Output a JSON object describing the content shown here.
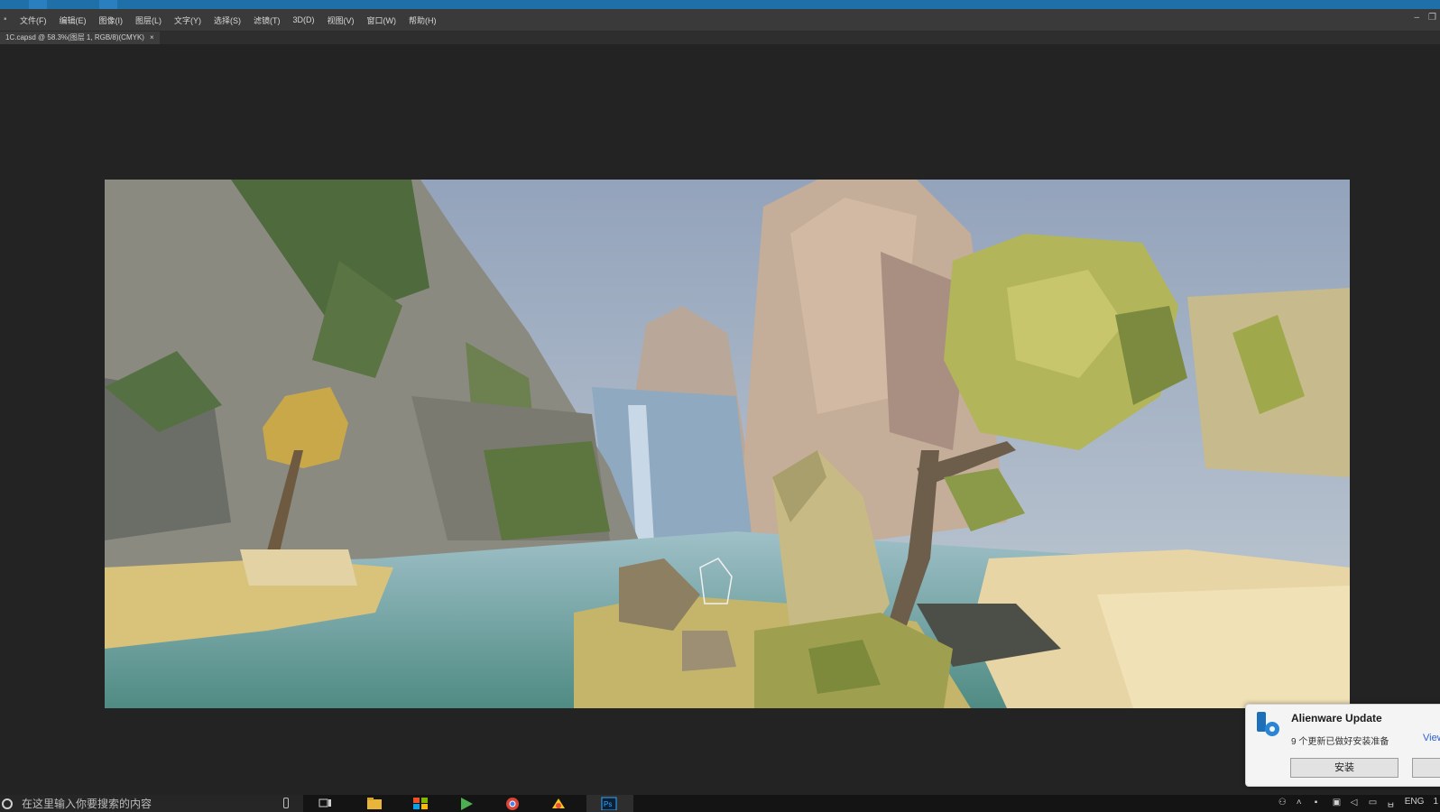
{
  "title_bar": {
    "tabs": [
      "",
      "",
      "",
      "",
      "",
      ""
    ]
  },
  "menubar": {
    "items": [
      "文件(F)",
      "编辑(E)",
      "图像(I)",
      "图层(L)",
      "文字(Y)",
      "选择(S)",
      "滤镜(T)",
      "3D(D)",
      "视图(V)",
      "窗口(W)",
      "帮助(H)"
    ]
  },
  "window_controls": {
    "minimize": "–",
    "restore": "❐"
  },
  "document_tab": {
    "label": "1C.capsd @ 58.3%(图层 1, RGB/8)(CMYK)",
    "close": "×"
  },
  "notification": {
    "title": "Alienware Update",
    "body": "9 个更新已做好安装准备",
    "link": "View",
    "install_button": "安装",
    "second_button": ""
  },
  "taskbar": {
    "search_placeholder": "在这里输入你要搜索的内容",
    "apps": [
      "task-view",
      "file-explorer",
      "store",
      "media",
      "chrome",
      "paint",
      "photoshop"
    ],
    "tray_text": "ENG",
    "clock": "1"
  },
  "colors": {
    "accent": "#1f6fa8",
    "menubar": "#3a3a3a",
    "workspace": "#232323",
    "taskbar": "#141414"
  }
}
